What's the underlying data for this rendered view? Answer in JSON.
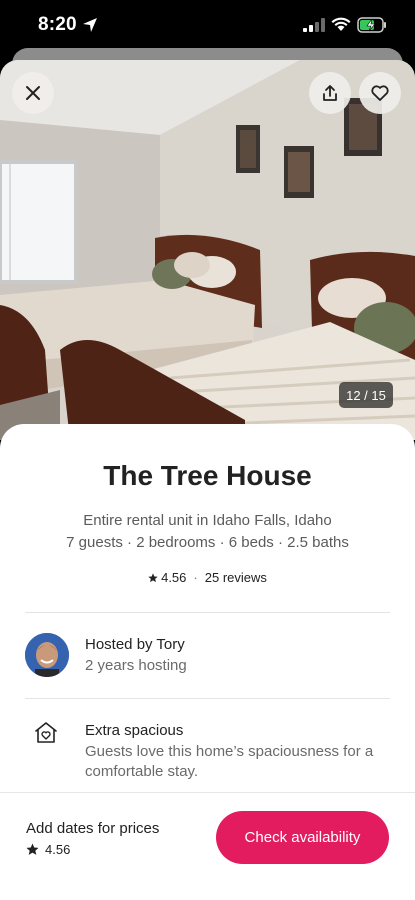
{
  "status_bar": {
    "time": "8:20",
    "icons": [
      "location-arrow-icon",
      "cellular-signal-icon",
      "wifi-icon",
      "battery-charging-icon"
    ]
  },
  "photo": {
    "counter": "12 / 15",
    "current": 12,
    "total": 15
  },
  "actions": {
    "close_icon": "close-icon",
    "share_icon": "share-icon",
    "save_icon": "heart-icon"
  },
  "listing": {
    "title": "The Tree House",
    "subtitle": "Entire rental unit in Idaho Falls, Idaho",
    "details": "7 guests · 2 bedrooms · 6 beds · 2.5 baths",
    "rating": "4.56",
    "reviews": "25 reviews"
  },
  "host": {
    "name": "Hosted by Tory",
    "years": "2 years hosting"
  },
  "feature": {
    "icon": "home-heart-icon",
    "title": "Extra spacious",
    "description": "Guests love this home’s spaciousness for a comfortable stay."
  },
  "footer": {
    "label": "Add dates for prices",
    "rating": "4.56",
    "cta": "Check availability"
  },
  "colors": {
    "brand": "#e31c5f",
    "text": "#222222",
    "muted": "#6a6a6a"
  }
}
